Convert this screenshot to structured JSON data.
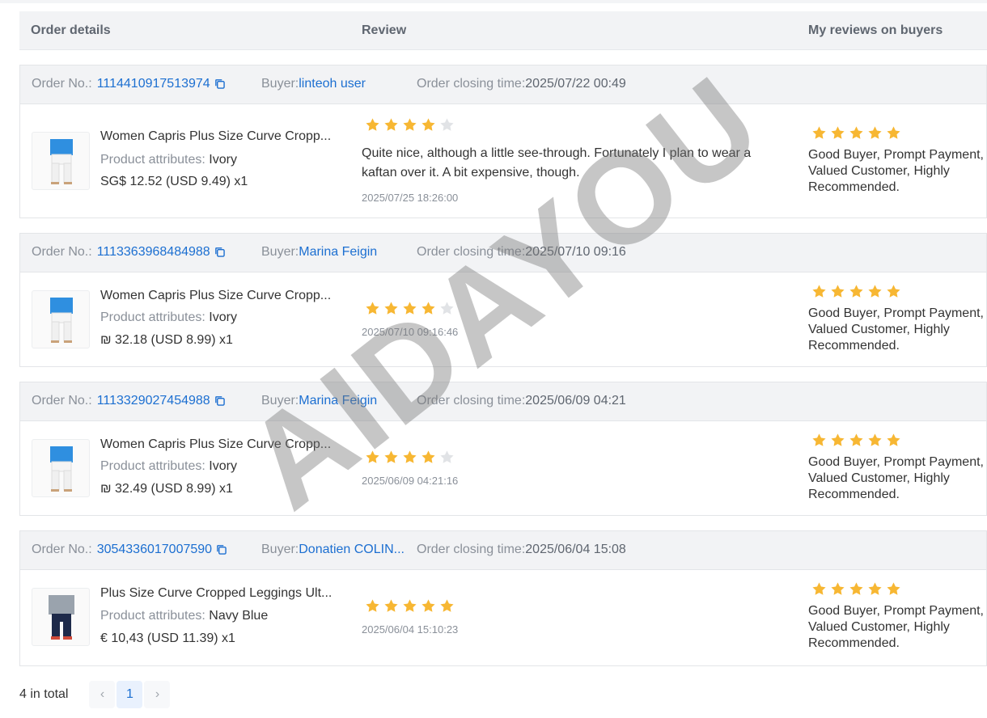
{
  "header": {
    "order_details": "Order details",
    "review": "Review",
    "my_reviews": "My reviews on buyers"
  },
  "labels": {
    "order_no": "Order No.:",
    "buyer": "Buyer:",
    "closing_time": "Order closing time:",
    "product_attributes": "Product attributes:"
  },
  "orders": [
    {
      "order_no": "1114410917513974",
      "buyer": "linteoh user",
      "closing_time": "2025/07/22 00:49",
      "product_title": "Women Capris Plus Size Curve Cropp...",
      "attribute": "Ivory",
      "price": "SG$ 12.52  (USD  9.49)  x1",
      "rating": 4,
      "review_text": "Quite nice, although a little see-through. Fortunately I plan to wear a kaftan over it. A bit expensive, though.",
      "review_date": "2025/07/25 18:26:00",
      "my_rating": 5,
      "my_review": "Good Buyer, Prompt Payment, Valued Customer, Highly Recommended."
    },
    {
      "order_no": "1113363968484988",
      "buyer": "Marina Feigin",
      "closing_time": "2025/07/10 09:16",
      "product_title": "Women Capris Plus Size Curve Cropp...",
      "attribute": "Ivory",
      "price": "₪ 32.18  (USD  8.99)  x1",
      "rating": 4,
      "review_text": "",
      "review_date": "2025/07/10 09:16:46",
      "my_rating": 5,
      "my_review": "Good Buyer, Prompt Payment, Valued Customer, Highly Recommended."
    },
    {
      "order_no": "1113329027454988",
      "buyer": "Marina Feigin",
      "closing_time": "2025/06/09 04:21",
      "product_title": "Women Capris Plus Size Curve Cropp...",
      "attribute": "Ivory",
      "price": "₪ 32.49  (USD  8.99)  x1",
      "rating": 4,
      "review_text": "",
      "review_date": "2025/06/09 04:21:16",
      "my_rating": 5,
      "my_review": "Good Buyer, Prompt Payment, Valued Customer, Highly Recommended."
    },
    {
      "order_no": "3054336017007590",
      "buyer": "Donatien COLIN...",
      "closing_time": "2025/06/04 15:08",
      "product_title": "Plus Size Curve Cropped Leggings Ult...",
      "attribute": "Navy Blue",
      "price": "€ 10,43  (USD  11.39)  x1",
      "rating": 5,
      "review_text": "",
      "review_date": "2025/06/04 15:10:23",
      "my_rating": 5,
      "my_review": "Good Buyer, Prompt Payment, Valued Customer, Highly Recommended."
    }
  ],
  "footer": {
    "total": "4 in total",
    "prev": "‹",
    "page": "1",
    "next": "›"
  },
  "watermark": "AIDAYOU",
  "colors": {
    "link": "#1c6fd1",
    "star_filled": "#f7b733",
    "star_empty": "#e1e3e6",
    "header_bg": "#f2f3f5"
  }
}
